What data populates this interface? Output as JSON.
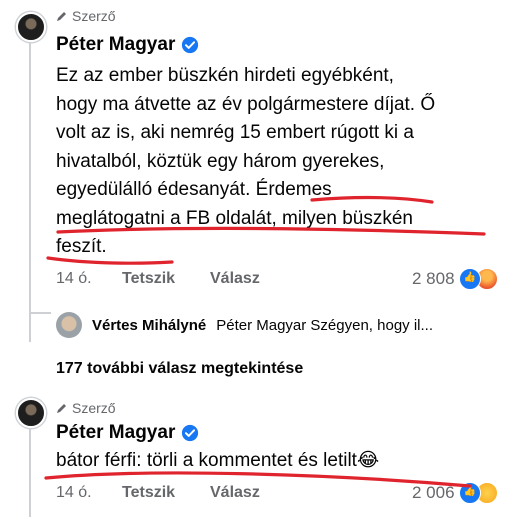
{
  "comments": [
    {
      "badge": "Szerző",
      "author": "Péter Magyar",
      "lines": [
        "Ez az ember büszkén hirdeti egyébként,",
        "hogy ma átvette az év polgármestere díjat. Ő",
        "volt az is, aki nemrég 15 embert rúgott ki a",
        "hivatalból, köztük egy három gyerekes,",
        "egyedülálló édesanyát. Érdemes",
        "meglátogatni a FB oldalát, milyen büszkén",
        "feszít."
      ],
      "time": "14 ó.",
      "like": "Tetszik",
      "reply": "Válasz",
      "reaction_count": "2 808"
    },
    {
      "badge": "Szerző",
      "author": "Péter Magyar",
      "lines": [
        "bátor férfi: törli a kommentet és letilt😂"
      ],
      "time": "14 ó.",
      "like": "Tetszik",
      "reply": "Válasz",
      "reaction_count": "2 006"
    }
  ],
  "reply_preview": {
    "author": "Vértes Mihályné",
    "text": "Péter Magyar Szégyen,  hogy il..."
  },
  "more_replies": "177 további válasz megtekintése",
  "colors": {
    "verified": "#1877f2",
    "annotation": "#e0242e",
    "secondary_text": "#65676b"
  }
}
